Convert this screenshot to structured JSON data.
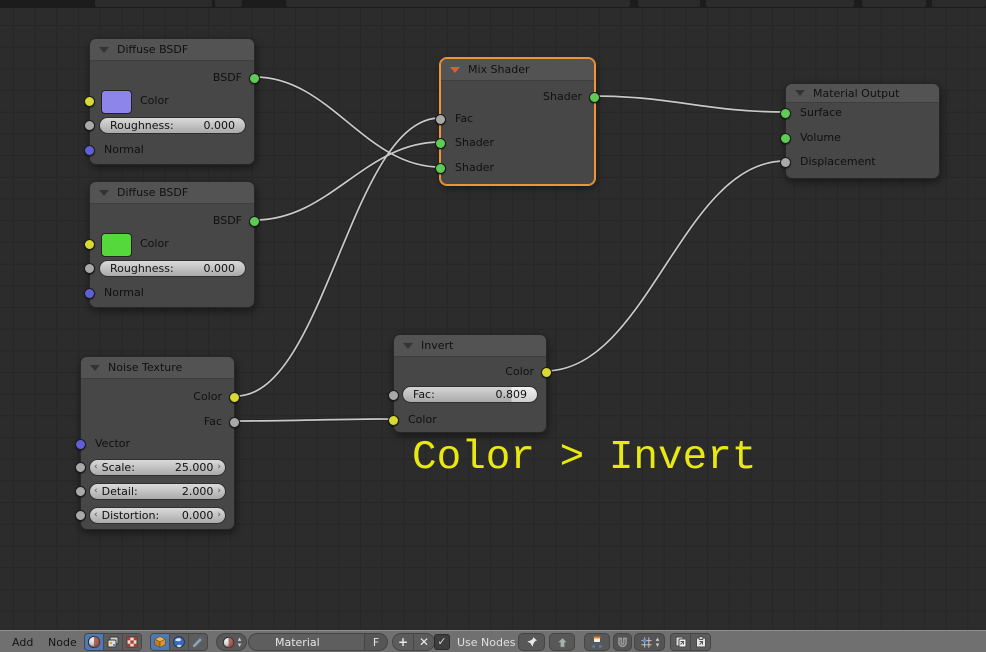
{
  "editor": "node-editor",
  "annotation": {
    "text": "Color > Invert",
    "color": "#e9e912"
  },
  "selection": {
    "selected_node": "Mix Shader",
    "outline_color": "#ef9537"
  },
  "socket_colors": {
    "shader": "#5ecb55",
    "color": "#d9d932",
    "value": "#a9a9a9",
    "vector": "#5f5fd8"
  },
  "nodes": {
    "diffuse1": {
      "title": "Diffuse BSDF",
      "output_label": "BSDF",
      "color_label": "Color",
      "color_swatch": "#8d85e9",
      "roughness": {
        "label": "Roughness:",
        "value": "0.000"
      },
      "normal_label": "Normal"
    },
    "diffuse2": {
      "title": "Diffuse BSDF",
      "output_label": "BSDF",
      "color_label": "Color",
      "color_swatch": "#55d83b",
      "roughness": {
        "label": "Roughness:",
        "value": "0.000"
      },
      "normal_label": "Normal"
    },
    "mix": {
      "title": "Mix Shader",
      "output_label": "Shader",
      "fac_label": "Fac",
      "shader1_label": "Shader",
      "shader2_label": "Shader"
    },
    "material_output": {
      "title": "Material Output",
      "surface_label": "Surface",
      "volume_label": "Volume",
      "displacement_label": "Displacement"
    },
    "noise": {
      "title": "Noise Texture",
      "color_out_label": "Color",
      "fac_out_label": "Fac",
      "vector_label": "Vector",
      "scale": {
        "label": "Scale:",
        "value": "25.000"
      },
      "detail": {
        "label": "Detail:",
        "value": "2.000"
      },
      "distortion": {
        "label": "Distortion:",
        "value": "0.000"
      }
    },
    "invert": {
      "title": "Invert",
      "color_out_label": "Color",
      "fac": {
        "label": "Fac:",
        "value": "0.809",
        "fill_percent": 81
      },
      "color_in_label": "Color"
    }
  },
  "connections": [
    {
      "from": "Diffuse BSDF (top).BSDF",
      "to": "Mix Shader.Shader (bottom)"
    },
    {
      "from": "Diffuse BSDF (bottom).BSDF",
      "to": "Mix Shader.Shader (top)"
    },
    {
      "from": "Noise Texture.Color",
      "to": "Mix Shader.Fac"
    },
    {
      "from": "Noise Texture.Fac",
      "to": "Invert.Color"
    },
    {
      "from": "Invert.Color",
      "to": "Material Output.Displacement"
    },
    {
      "from": "Mix Shader.Shader",
      "to": "Material Output.Surface"
    }
  ],
  "toolbar": {
    "menu_add": "Add",
    "menu_node": "Node",
    "material_name": "Material",
    "fake_user_label": "F",
    "new_label": "+",
    "unlink_label": "✕",
    "use_nodes_checked": "✓",
    "use_nodes_label": "Use Nodes",
    "stepper_up": "▴",
    "stepper_down": "▾",
    "icons": [
      "shader-tree-icon",
      "compositing-tree-icon",
      "texture-tree-icon",
      "object-shader-icon",
      "world-shader-icon",
      "linestyle-shader-icon",
      "material-preview-icon",
      "pin-icon",
      "go-to-parent-icon",
      "auto-offset-icon",
      "snap-magnet-icon",
      "snap-grid-icon",
      "copy-nodes-icon",
      "paste-nodes-icon"
    ],
    "slider_arrow_left": "‹",
    "slider_arrow_right": "›"
  }
}
